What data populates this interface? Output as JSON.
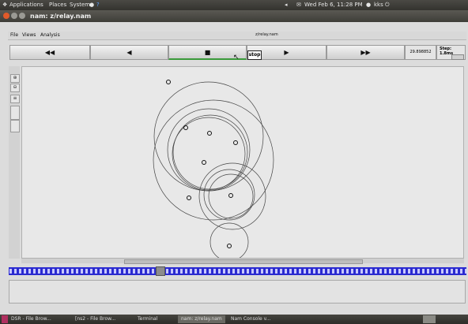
{
  "top_panel": {
    "menus": [
      "Applications",
      "Places",
      "System"
    ],
    "clock": "Wed Feb  6, 11:28 PM",
    "user": "kks"
  },
  "window": {
    "title": "nam: z/relay.nam",
    "subtitle": "z/relay.nam"
  },
  "menubar": {
    "file": "File",
    "views": "Views",
    "analysis": "Analysis"
  },
  "controls": {
    "rewind": "◀◀",
    "back": "◀",
    "stop": "■",
    "play": "▶",
    "fast_forward": "▶▶",
    "tooltip": "stop",
    "time": "29.898852",
    "step_label": "Step: 1.8ms"
  },
  "taskbar": {
    "items": [
      "DSR - File Brow...",
      "[ns2 - File Brow...",
      "Terminal",
      "nam: z/relay.nam",
      "Nam Console v..."
    ]
  },
  "colors": {
    "canvas_bg": "#e8e8e8",
    "timeline": "#2a2ad0",
    "panel": "#3c3b37",
    "play_active": "#3a9a3a"
  }
}
